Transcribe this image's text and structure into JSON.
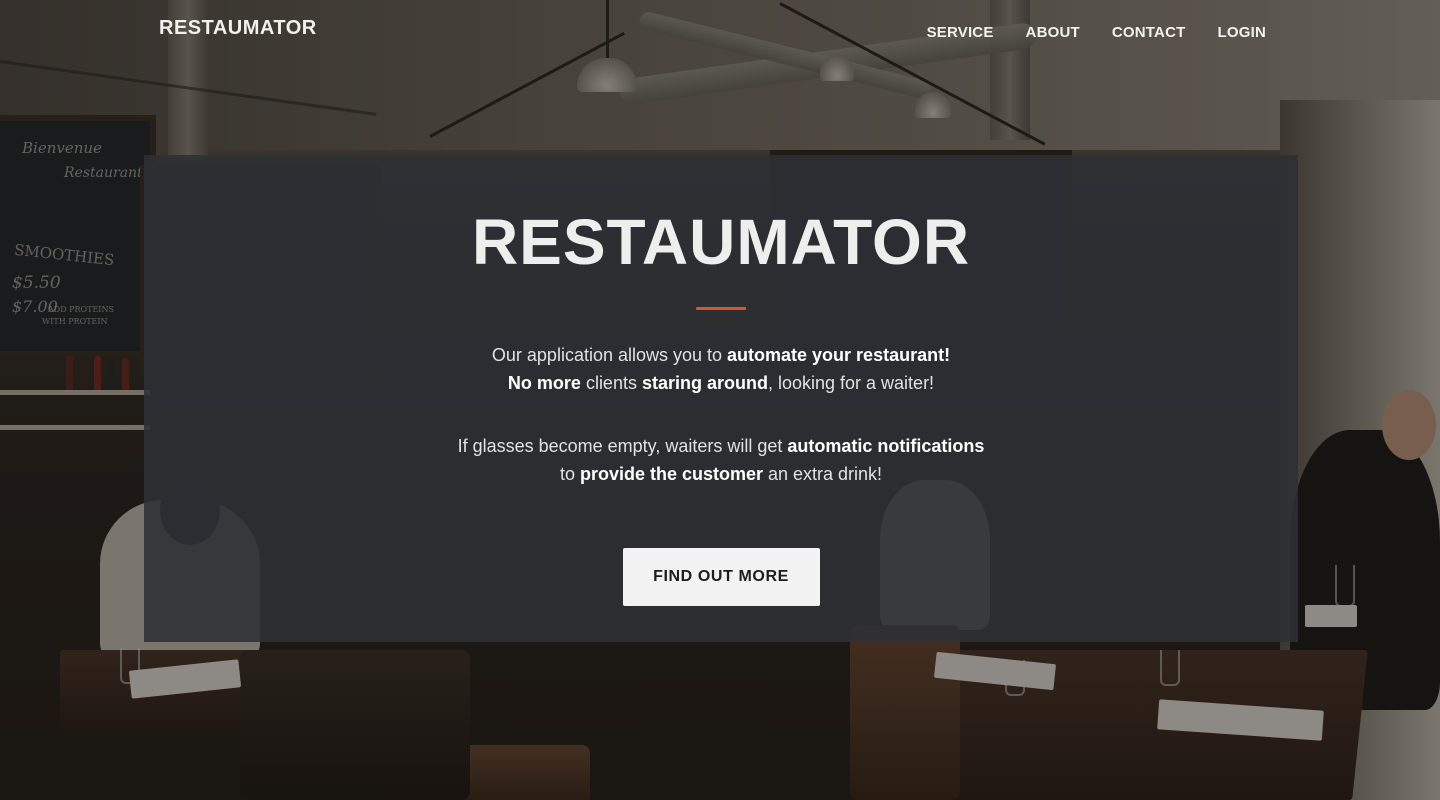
{
  "header": {
    "brand": "RESTAUMATOR",
    "nav": [
      {
        "label": "SERVICE"
      },
      {
        "label": "ABOUT"
      },
      {
        "label": "CONTACT"
      },
      {
        "label": "LOGIN"
      }
    ]
  },
  "hero": {
    "title": "RESTAUMATOR",
    "paragraph1": {
      "line1": {
        "a": "Our application allows you to ",
        "b": "automate your restaurant!"
      },
      "line2": {
        "a": "No more",
        "b": " clients ",
        "c": "staring around",
        "d": ", looking for a waiter!"
      }
    },
    "paragraph2": {
      "line1": {
        "a": "If glasses become empty, waiters will get ",
        "b": "automatic notifications"
      },
      "line2": {
        "a": "to ",
        "b": "provide the customer",
        "c": " an extra drink!"
      }
    },
    "cta_label": "FIND OUT MORE"
  },
  "background": {
    "chalkboard_text": [
      "Bienvenue",
      "Restaurant",
      "SMOOTHIES",
      "$5.50",
      "$7.00",
      "ADD PROTEINS",
      "WITH PROTEIN"
    ]
  },
  "colors": {
    "accent": "#d9572d",
    "panel": "#2d3036",
    "cta_bg": "#f2f2f2",
    "text": "#ffffff"
  }
}
